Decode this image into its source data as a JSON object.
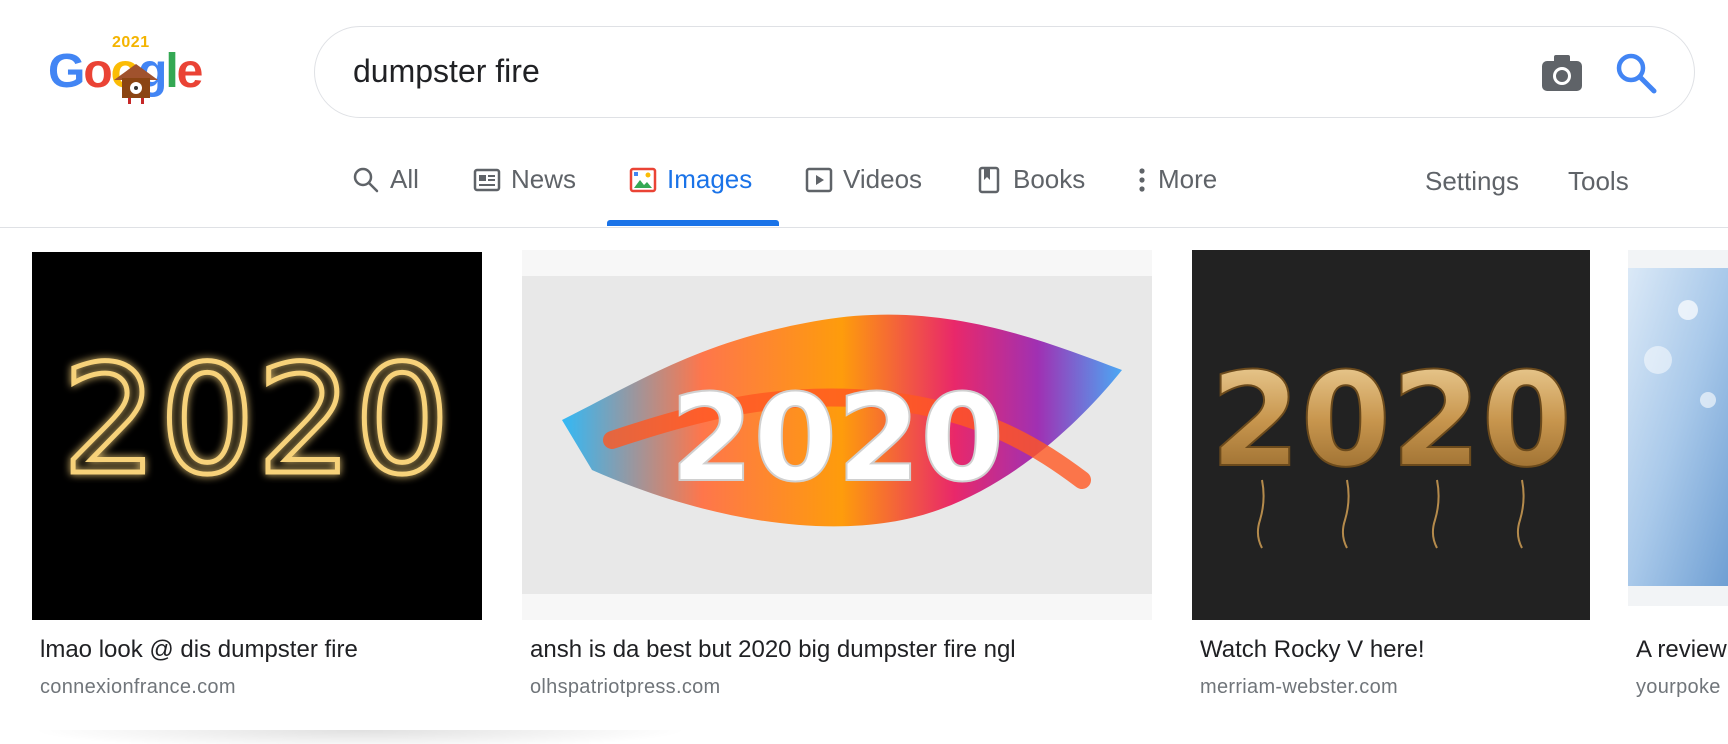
{
  "logo": {
    "year": "2021",
    "letters": [
      "G",
      "o",
      "o",
      "g",
      "l",
      "e"
    ]
  },
  "search": {
    "query": "dumpster fire"
  },
  "tabs": [
    {
      "label": "All",
      "icon": "search-icon"
    },
    {
      "label": "News",
      "icon": "newspaper-icon"
    },
    {
      "label": "Images",
      "icon": "image-icon",
      "active": true
    },
    {
      "label": "Videos",
      "icon": "play-icon"
    },
    {
      "label": "Books",
      "icon": "book-icon"
    },
    {
      "label": "More",
      "icon": "more-vert-icon"
    }
  ],
  "tools": {
    "settings": "Settings",
    "tools": "Tools"
  },
  "results": [
    {
      "image_text": "2020",
      "title": "lmao look @ dis dumpster fire",
      "source": "connexionfrance.com"
    },
    {
      "image_text": "2020",
      "title": "ansh is da best but 2020 big dumpster fire ngl",
      "source": "olhspatriotpress.com"
    },
    {
      "image_text": "2020",
      "title": "Watch Rocky V here!",
      "source": "merriam-webster.com"
    },
    {
      "title": "A review",
      "source": "yourpoke"
    }
  ],
  "colors": {
    "accent": "#1a73e8",
    "muted": "#5f6368",
    "source": "#70757a"
  }
}
